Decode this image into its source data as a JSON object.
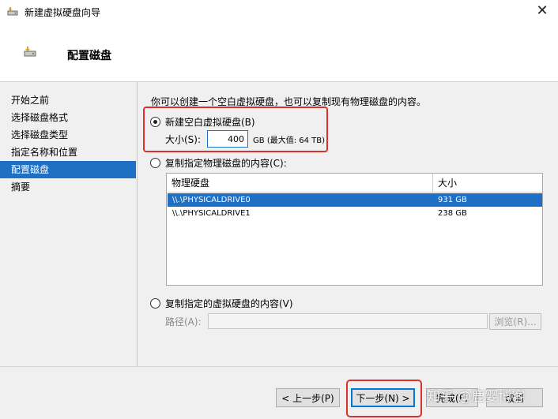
{
  "window": {
    "title": "新建虚拟硬盘向导",
    "close_glyph": "✕"
  },
  "header": {
    "title": "配置磁盘"
  },
  "sidebar": {
    "items": [
      {
        "label": "开始之前",
        "active": false
      },
      {
        "label": "选择磁盘格式",
        "active": false
      },
      {
        "label": "选择磁盘类型",
        "active": false
      },
      {
        "label": "指定名称和位置",
        "active": false
      },
      {
        "label": "配置磁盘",
        "active": true
      },
      {
        "label": "摘要",
        "active": false
      }
    ]
  },
  "main": {
    "intro": "你可以创建一个空白虚拟硬盘，也可以复制现有物理磁盘的内容。",
    "option_new": {
      "label": "新建空白虚拟硬盘(B)",
      "checked": true
    },
    "size": {
      "label": "大小(S):",
      "value": "400",
      "unit_text": "GB (最大值: 64 TB)"
    },
    "option_physical": {
      "label": "复制指定物理磁盘的内容(C):",
      "checked": false
    },
    "table": {
      "columns": [
        "物理硬盘",
        "大小"
      ],
      "rows": [
        {
          "disk": "\\\\.\\PHYSICALDRIVE0",
          "size": "931 GB",
          "selected": true
        },
        {
          "disk": "\\\\.\\PHYSICALDRIVE1",
          "size": "238 GB",
          "selected": false
        }
      ]
    },
    "option_virtual": {
      "label": "复制指定的虚拟硬盘的内容(V)",
      "checked": false
    },
    "path": {
      "label": "路径(A):",
      "value": ""
    },
    "browse_label": "浏览(R)..."
  },
  "footer": {
    "prev_label": "< 上一步(P)",
    "next_label": "下一步(N) >",
    "finish_label": "完成(F)",
    "cancel_label": "取消"
  },
  "watermark": "知乎 @鹿婴博客",
  "colors": {
    "accent": "#1f6fc5",
    "highlight": "#e0302b"
  }
}
